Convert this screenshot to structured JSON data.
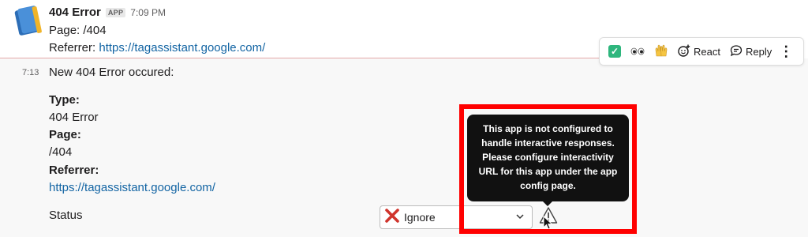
{
  "message": {
    "sender": "404 Error",
    "badge": "APP",
    "time": "7:09 PM",
    "page_line": "Page: /404",
    "referrer_label": "Referrer: ",
    "referrer_url": "https://tagassistant.google.com/"
  },
  "toolbar": {
    "check_icon": "✓",
    "eyes_icon": "👀",
    "clap_icon": "🙌",
    "react_label": "React",
    "reply_label": "Reply",
    "more_icon": "⋮"
  },
  "followup": {
    "timestamp": "7:13",
    "title": "New 404 Error occured:",
    "type_label": "Type:",
    "type_value": "404 Error",
    "page_label": "Page:",
    "page_value": "/404",
    "referrer_label": "Referrer:",
    "referrer_value": "https://tagassistant.google.com/",
    "status_label": "Status"
  },
  "select": {
    "x_icon": "✕",
    "value": "Ignore",
    "chevron": "⌄"
  },
  "tooltip": {
    "text": "This app is not configured to handle interactive responses. Please configure interactivity URL for this app under the app config page."
  },
  "colors": {
    "link": "#1264a3",
    "highlight_frame": "#ff0000",
    "tooltip_bg": "#111111",
    "checkmark": "#2eb67d",
    "ignore_x": "#d0342c"
  }
}
